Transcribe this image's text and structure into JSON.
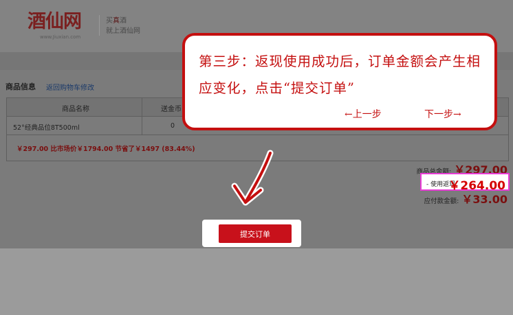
{
  "header": {
    "logo_text": "酒仙网",
    "logo_url": "www.Jiuxian.com",
    "slogan_pre": "买",
    "slogan_hl": "真",
    "slogan_post": "酒",
    "slogan_line2": "就上酒仙网"
  },
  "section": {
    "title": "商品信息",
    "back_link": "返回购物车修改"
  },
  "table": {
    "headers": [
      "商品名称",
      "送金币"
    ],
    "rows": [
      {
        "name": "52°经典品位8T500ml",
        "coins": "0"
      }
    ],
    "savings": "￥297.00 比市场价￥1794.00 节省了￥1497 (83.44%)"
  },
  "totals": {
    "goods_label": "商品总金额:",
    "goods_value": "￥297.00",
    "cash_label": "- 使用返现:",
    "cash_value": "￥264.00",
    "pay_label": "应付款金额:",
    "pay_value": "￥33.00"
  },
  "submit": {
    "label": "提交订单"
  },
  "callout": {
    "text": "第三步：返现使用成功后，订单金额会产生相应变化，点击“提交订单”",
    "prev": "←上一步",
    "next": "下一步→"
  },
  "colors": {
    "accent": "#c40f0f",
    "highlight_border": "#e83bd5"
  }
}
